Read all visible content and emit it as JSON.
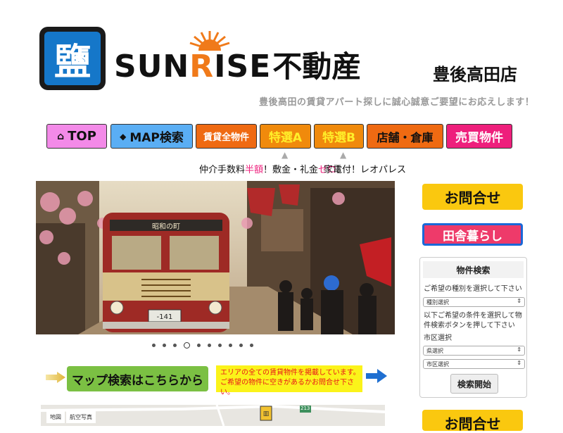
{
  "header": {
    "logo_kanji": "鹽",
    "brand_latin_1": "SUN",
    "brand_latin_r": "R",
    "brand_latin_2": "ISE",
    "brand_jp": "不動産",
    "branch": "豊後高田店",
    "tagline": "豊後高田の賃貸アパート探しに誠心誠意ご要望にお応えします！"
  },
  "nav": {
    "top": "TOP",
    "map": "MAP検索",
    "all": "賃貸全物件",
    "special_a": "特選A",
    "special_b": "特選B",
    "shop": "店舗・倉庫",
    "sale": "売買物件"
  },
  "notes": {
    "a_pre": "仲介手数料",
    "a_half": "半額",
    "a_mid": "！敷金・礼金",
    "a_zero": "ゼロ",
    "a_end": "！",
    "b": "家電付！レオパレス"
  },
  "slider": {
    "bus_sign": "昭和の町",
    "plate": "-141",
    "dots_total": 10,
    "active_index": 3
  },
  "sidebar": {
    "contact": "お問合せ",
    "countryside": "田舎暮らし",
    "contact_bottom": "お問合せ",
    "search": {
      "title": "物件検索",
      "type_label": "ご希望の種別を選択して下さい",
      "type_select": "種別選択",
      "help": "以下ご希望の条件を選択して物件検索ボタンを押して下さい",
      "area_label": "市区選択",
      "pref_select": "県選択",
      "city_select": "市区選択",
      "go": "検索開始"
    }
  },
  "map_search": {
    "button": "マップ検索はこちらから",
    "note_line1": "エリアの全ての賃貸物件を掲載しています。",
    "note_line2": "ご希望の物件に空きがあるかお問合せ下さい。"
  },
  "map_preview": {
    "tab_map": "地図",
    "tab_aerial": "航空写真",
    "road": "213"
  },
  "colors": {
    "accent_orange": "#ef6a12",
    "pink": "#ee1f7c",
    "yellow": "#fac80f",
    "blue": "#1577c9"
  }
}
